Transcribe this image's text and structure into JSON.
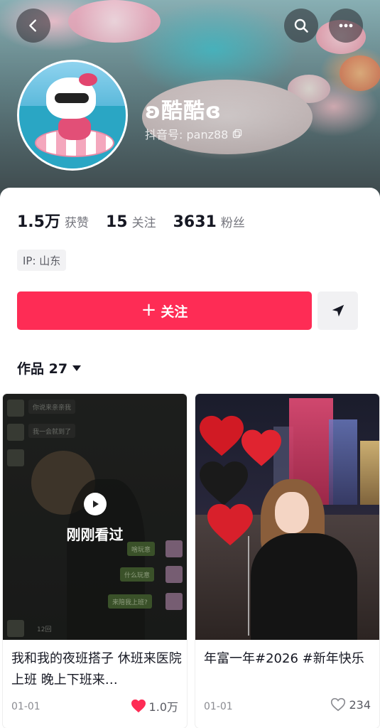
{
  "header": {
    "back_icon": "chevron-left-icon",
    "search_icon": "search-icon",
    "more_icon": "more-horizontal-icon"
  },
  "profile": {
    "nickname": "ʚ酷酷ɞ",
    "handle_label": "抖音号: panz88",
    "copy_icon": "copy-icon"
  },
  "stats": [
    {
      "value": "1.5万",
      "label": "获赞"
    },
    {
      "value": "15",
      "label": "关注"
    },
    {
      "value": "3631",
      "label": "粉丝"
    }
  ],
  "ip_tag": "IP: 山东",
  "actions": {
    "follow_label": "关注",
    "share_icon": "send-icon"
  },
  "works": {
    "tab_label": "作品 27",
    "posts": [
      {
        "overlay_label": "刚刚看过",
        "caption": "我和我的夜班搭子 休班来医院上班 晚上下班来…",
        "date": "01-01",
        "likes": "1.0万",
        "liked": true,
        "chat_lines": [
          "你说来亲亲我",
          "我一会就到了",
          "啥玩意",
          "什么玩意",
          "来陪我上班?",
          "12回"
        ]
      },
      {
        "caption": "年富一年#2026 #新年快乐",
        "date": "01-01",
        "likes": "234",
        "liked": false
      }
    ]
  },
  "colors": {
    "accent": "#fe2c55",
    "text_primary": "#161823",
    "text_secondary": "#75767e"
  }
}
